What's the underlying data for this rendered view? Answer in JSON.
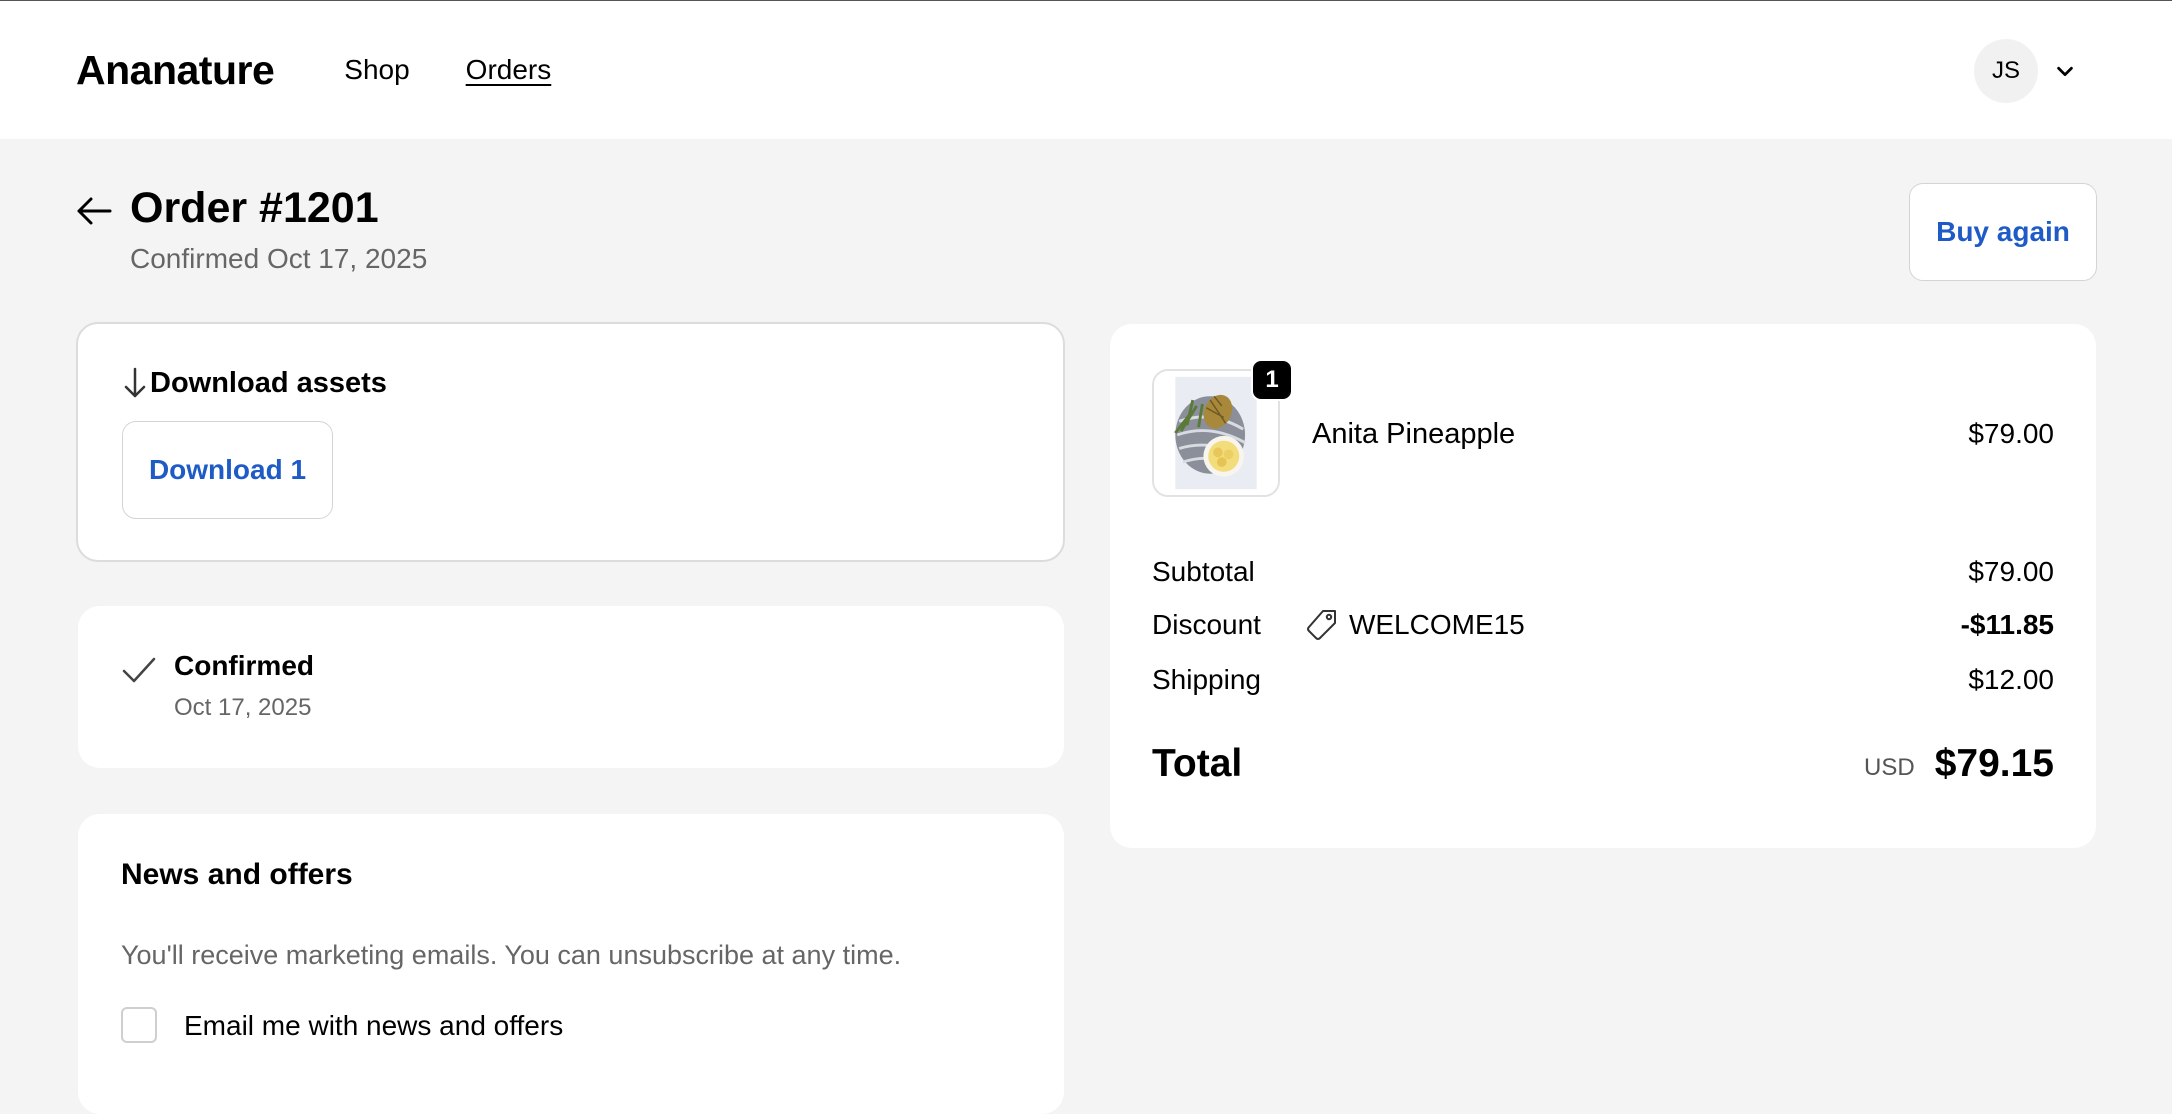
{
  "header": {
    "brand": "Ananature",
    "nav": [
      {
        "label": "Shop",
        "active": false
      },
      {
        "label": "Orders",
        "active": true
      }
    ],
    "account": {
      "initials": "JS"
    }
  },
  "order": {
    "title": "Order #1201",
    "subtitle": "Confirmed Oct 17, 2025",
    "buy_again_label": "Buy again"
  },
  "downloads": {
    "heading": "Download assets",
    "button_label": "Download 1"
  },
  "status": {
    "label": "Confirmed",
    "date": "Oct 17, 2025"
  },
  "news": {
    "title": "News and offers",
    "description": "You'll receive marketing emails. You can unsubscribe at any time.",
    "checkbox_label": "Email me with news and offers",
    "checked": false
  },
  "summary": {
    "item": {
      "name": "Anita Pineapple",
      "price": "$79.00",
      "quantity": "1"
    },
    "subtotal_label": "Subtotal",
    "subtotal": "$79.00",
    "discount_label": "Discount",
    "discount_code": "WELCOME15",
    "discount": "-$11.85",
    "shipping_label": "Shipping",
    "shipping": "$12.00",
    "total_label": "Total",
    "currency": "USD",
    "total": "$79.15"
  },
  "colors": {
    "accent": "#1f5bc6",
    "page_bg": "#f4f4f4",
    "muted_text": "#666666"
  },
  "icons": [
    "back-arrow-icon",
    "download-icon",
    "check-icon",
    "tag-icon",
    "chevron-down-icon"
  ]
}
